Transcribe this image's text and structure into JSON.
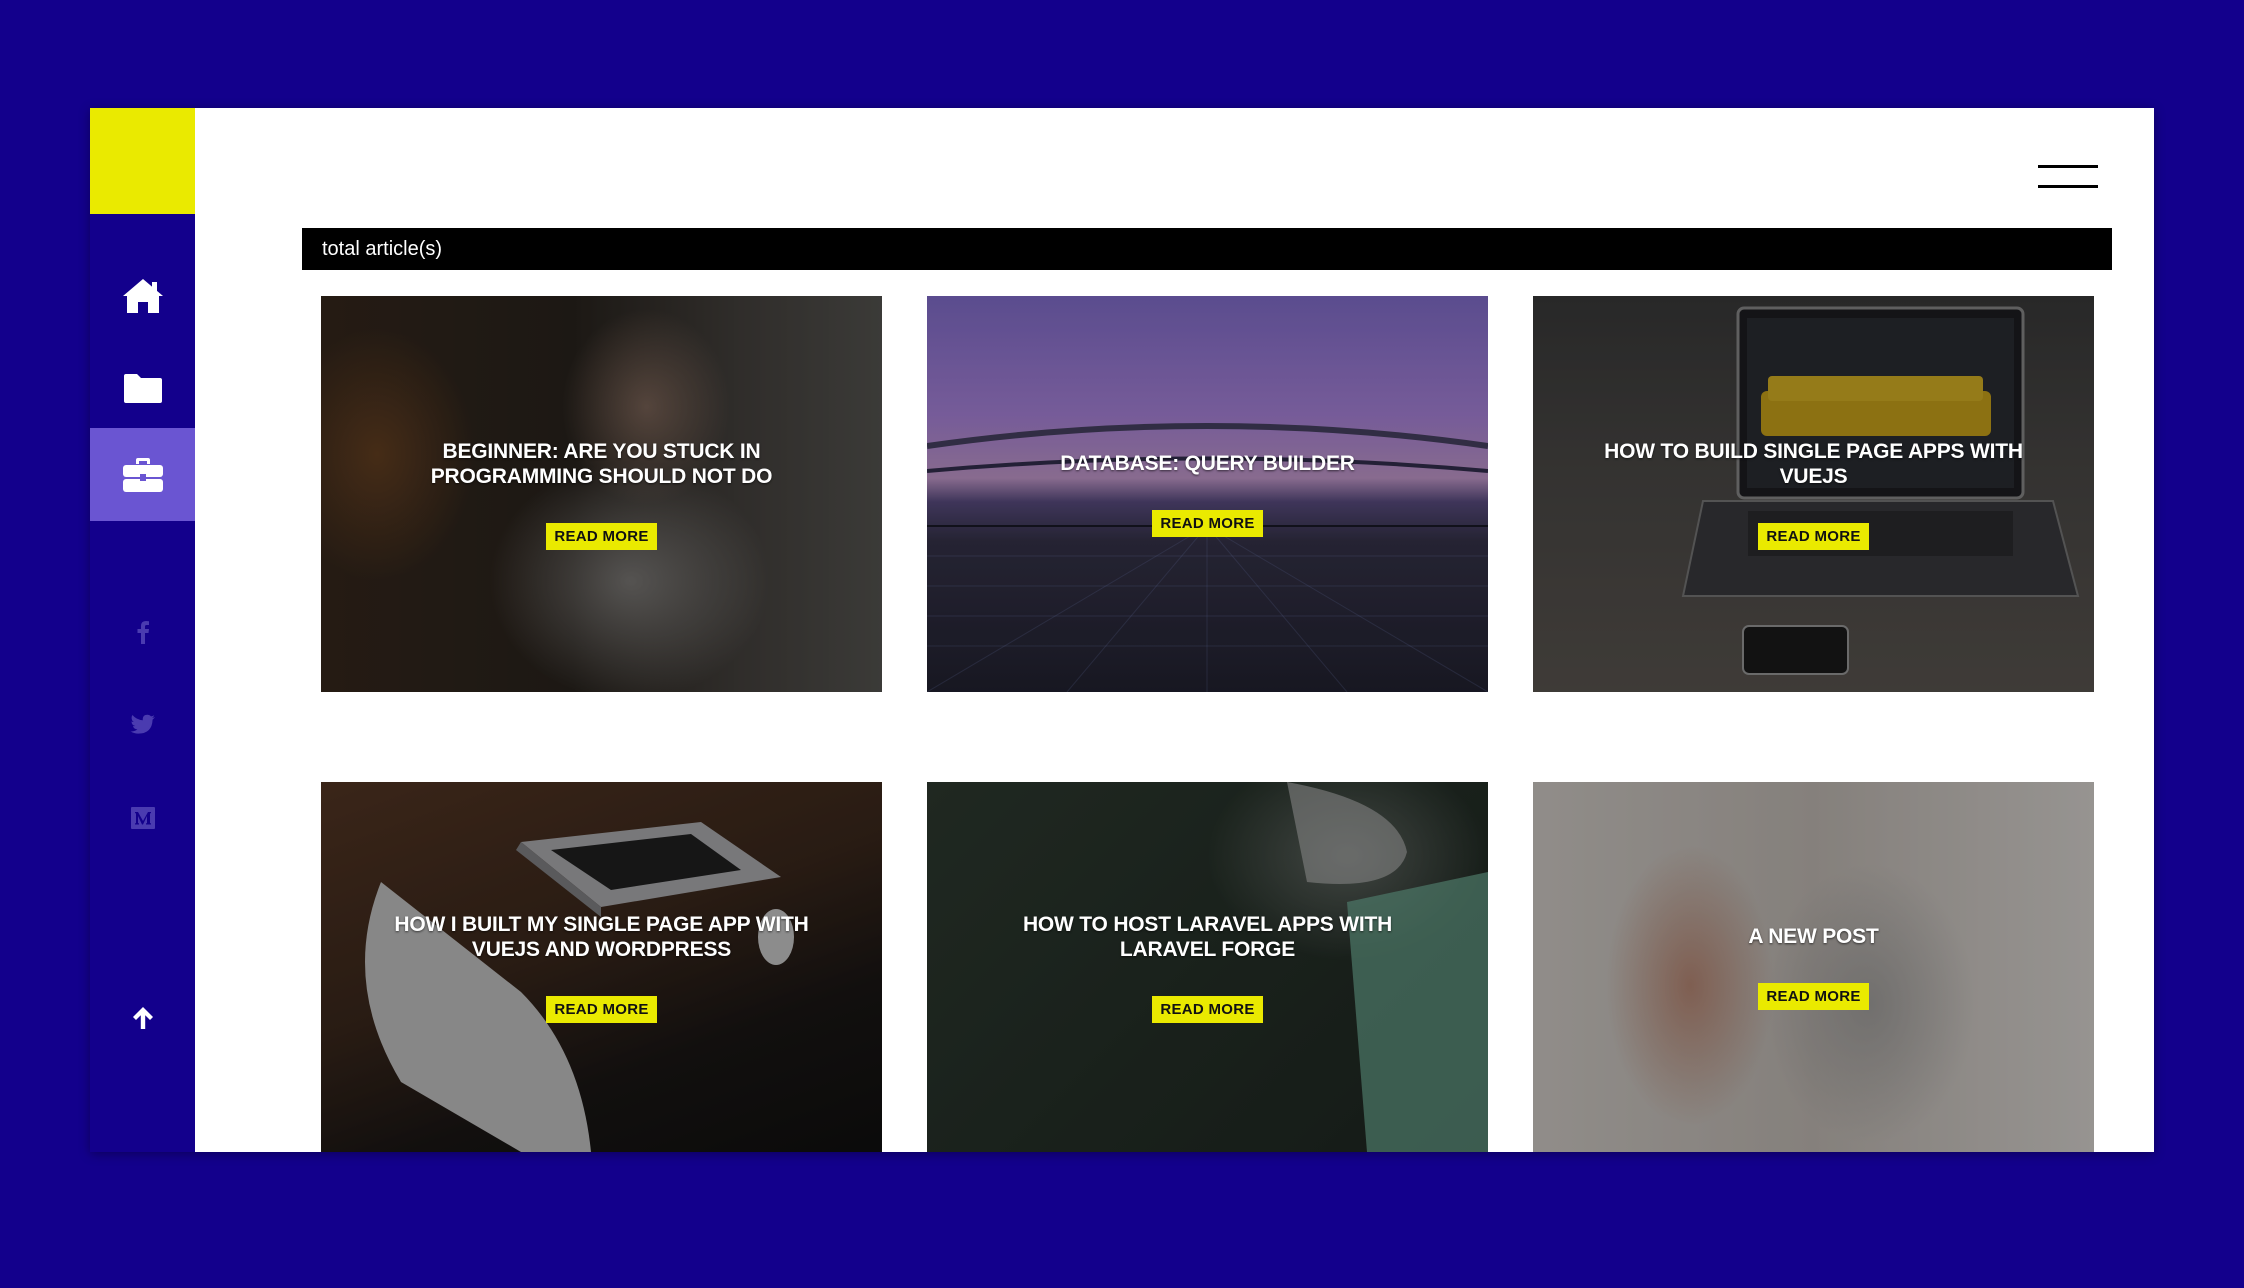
{
  "header": {
    "total_label": "total article(s)"
  },
  "nav": {
    "items": [
      {
        "name": "home",
        "icon": "home-icon",
        "active": false
      },
      {
        "name": "folder",
        "icon": "folder-icon",
        "active": false
      },
      {
        "name": "portfolio",
        "icon": "briefcase-icon",
        "active": true
      }
    ],
    "social": [
      {
        "icon": "facebook-icon"
      },
      {
        "icon": "twitter-icon"
      },
      {
        "icon": "medium-icon"
      }
    ],
    "scroll_top": {
      "icon": "arrow-up-icon"
    }
  },
  "articles": [
    {
      "title": "BEGINNER: ARE YOU STUCK IN PROGRAMMING SHOULD NOT DO",
      "cta": "READ MORE"
    },
    {
      "title": "DATABASE: QUERY BUILDER",
      "cta": "READ MORE"
    },
    {
      "title": "HOW TO BUILD SINGLE PAGE APPS WITH VUEJS",
      "cta": "READ MORE"
    },
    {
      "title": "HOW I BUILT MY SINGLE PAGE APP WITH VUEJS AND WORDPRESS",
      "cta": "READ MORE"
    },
    {
      "title": "HOW TO HOST LARAVEL APPS WITH LARAVEL FORGE",
      "cta": "READ MORE"
    },
    {
      "title": "A NEW POST",
      "cta": "READ MORE"
    }
  ],
  "colors": {
    "background": "#13008c",
    "accent_yellow": "#eaea00",
    "active_nav": "#6a55d2",
    "muted_icon": "#4a3bb0"
  }
}
